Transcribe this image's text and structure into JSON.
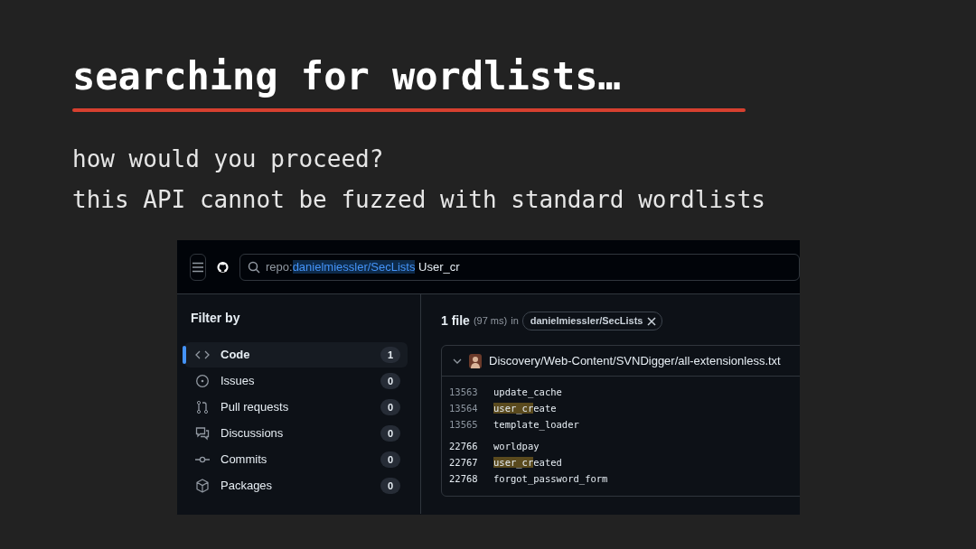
{
  "slide": {
    "title": "searching for wordlists…",
    "lines": [
      "how would you proceed?",
      "this API cannot be fuzzed with standard wordlists"
    ]
  },
  "screenshot": {
    "search": {
      "qualifier": "repo:",
      "value": "danielmiessler/SecLists",
      "query": " User_cr"
    },
    "sidebar": {
      "heading": "Filter by",
      "items": [
        {
          "kind": "code",
          "label": "Code",
          "count": "1",
          "selected": true
        },
        {
          "kind": "issues",
          "label": "Issues",
          "count": "0",
          "selected": false
        },
        {
          "kind": "pulls",
          "label": "Pull requests",
          "count": "0",
          "selected": false
        },
        {
          "kind": "discussions",
          "label": "Discussions",
          "count": "0",
          "selected": false
        },
        {
          "kind": "commits",
          "label": "Commits",
          "count": "0",
          "selected": false
        },
        {
          "kind": "packages",
          "label": "Packages",
          "count": "0",
          "selected": false
        }
      ]
    },
    "results": {
      "count": "1 file",
      "timing": "(97 ms)",
      "in": "in",
      "repo_filter": "danielmiessler/SecLists",
      "file": {
        "expanded": true,
        "path": "Discovery/Web-Content/SVNDigger/all-extensionless.txt",
        "snippets": [
          {
            "dimmed": true,
            "lines": [
              {
                "number": "13563",
                "rest": "update_cache"
              },
              {
                "number": "13564",
                "match": "user_cr",
                "rest": "eate"
              },
              {
                "number": "13565",
                "rest": "template_loader"
              }
            ]
          },
          {
            "dimmed": false,
            "lines": [
              {
                "number": "22766",
                "rest": "worldpay"
              },
              {
                "number": "22767",
                "match": "user_cr",
                "rest": "eated"
              },
              {
                "number": "22768",
                "rest": "forgot_password_form"
              }
            ]
          }
        ]
      }
    }
  }
}
